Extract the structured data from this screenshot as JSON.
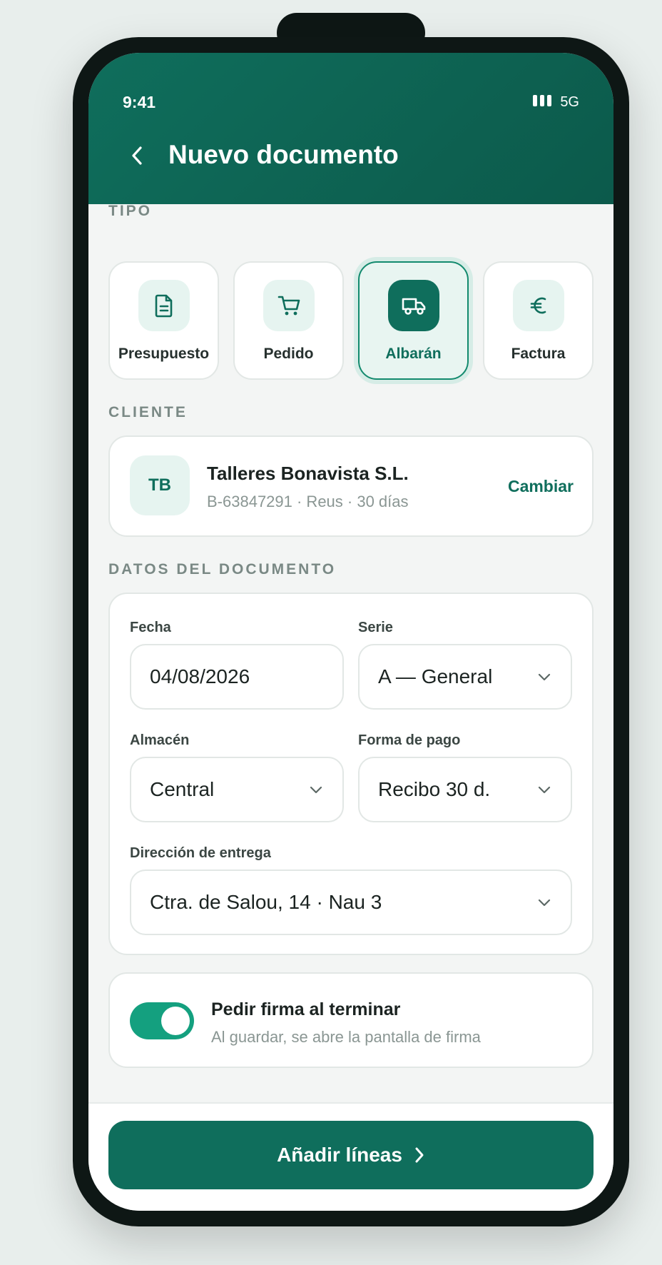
{
  "status": {
    "time": "9:41",
    "network": "5G"
  },
  "header": {
    "title": "Nuevo documento"
  },
  "sections": {
    "tipo": "TIPO",
    "cliente": "CLIENTE",
    "datos": "DATOS DEL DOCUMENTO"
  },
  "types": [
    {
      "label": "Presupuesto",
      "icon": "document-icon",
      "active": false
    },
    {
      "label": "Pedido",
      "icon": "cart-icon",
      "active": false
    },
    {
      "label": "Albarán",
      "icon": "truck-icon",
      "active": true
    },
    {
      "label": "Factura",
      "icon": "euro-icon",
      "active": false
    }
  ],
  "client": {
    "initials": "TB",
    "name": "Talleres Bonavista S.L.",
    "meta": "B-63847291 · Reus · 30 días",
    "change_label": "Cambiar"
  },
  "fields": {
    "fecha": {
      "label": "Fecha",
      "value": "04/08/2026"
    },
    "serie": {
      "label": "Serie",
      "value": "A — General"
    },
    "almacen": {
      "label": "Almacén",
      "value": "Central"
    },
    "forma_pago": {
      "label": "Forma de pago",
      "value": "Recibo 30 d."
    },
    "direccion": {
      "label": "Dirección de entrega",
      "value": "Ctra. de Salou, 14 · Nau 3"
    }
  },
  "signature": {
    "title": "Pedir firma al terminar",
    "subtitle": "Al guardar, se abre la pantalla de firma",
    "enabled": true
  },
  "cta": {
    "label": "Añadir líneas"
  },
  "colors": {
    "brand": "#0f6e5c",
    "toggle": "#14a07f"
  }
}
